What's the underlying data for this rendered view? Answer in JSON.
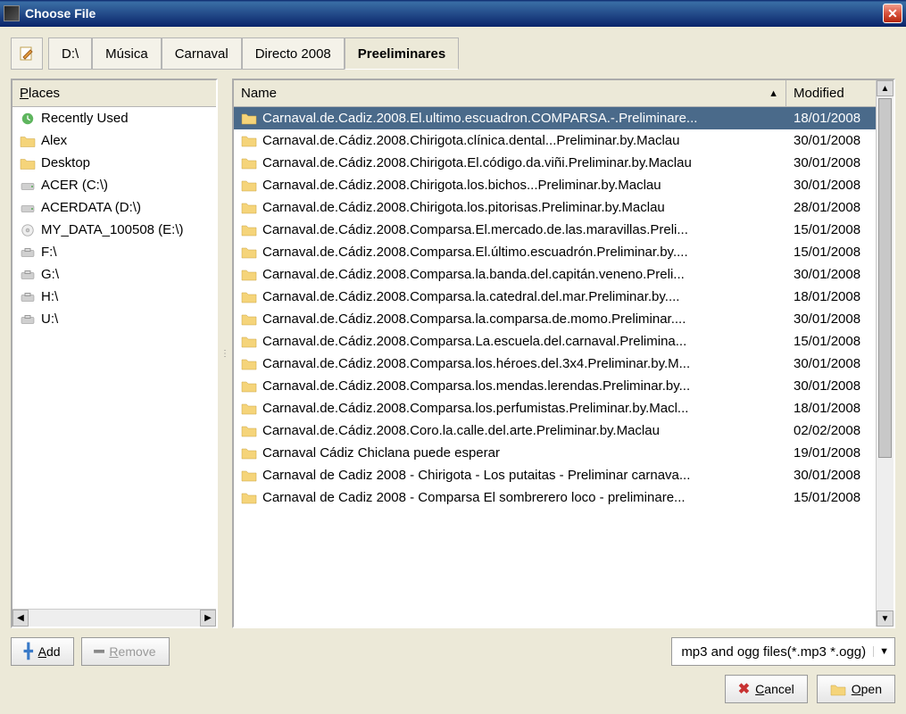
{
  "window": {
    "title": "Choose File"
  },
  "breadcrumb": [
    "D:\\",
    "Música",
    "Carnaval",
    "Directo 2008",
    "Preeliminares"
  ],
  "breadcrumb_active_index": 4,
  "places": {
    "header": "Places",
    "items": [
      {
        "label": "Recently Used",
        "icon": "recent"
      },
      {
        "label": "Alex",
        "icon": "folder"
      },
      {
        "label": "Desktop",
        "icon": "folder"
      },
      {
        "label": "ACER (C:\\)",
        "icon": "drive"
      },
      {
        "label": "ACERDATA (D:\\)",
        "icon": "drive"
      },
      {
        "label": "MY_DATA_100508 (E:\\)",
        "icon": "cd"
      },
      {
        "label": "F:\\",
        "icon": "removable"
      },
      {
        "label": "G:\\",
        "icon": "removable"
      },
      {
        "label": "H:\\",
        "icon": "removable"
      },
      {
        "label": "U:\\",
        "icon": "removable"
      }
    ]
  },
  "files": {
    "col_name": "Name",
    "col_modified": "Modified",
    "rows": [
      {
        "name": "Carnaval.de.Cadiz.2008.El.ultimo.escuadron.COMPARSA.-.Preliminare...",
        "modified": "18/01/2008",
        "selected": true
      },
      {
        "name": "Carnaval.de.Cádiz.2008.Chirigota.clínica.dental...Preliminar.by.Maclau",
        "modified": "30/01/2008"
      },
      {
        "name": "Carnaval.de.Cádiz.2008.Chirigota.El.código.da.viñi.Preliminar.by.Maclau",
        "modified": "30/01/2008"
      },
      {
        "name": "Carnaval.de.Cádiz.2008.Chirigota.los.bichos...Preliminar.by.Maclau",
        "modified": "30/01/2008"
      },
      {
        "name": "Carnaval.de.Cádiz.2008.Chirigota.los.pitorisas.Preliminar.by.Maclau",
        "modified": "28/01/2008"
      },
      {
        "name": "Carnaval.de.Cádiz.2008.Comparsa.El.mercado.de.las.maravillas.Preli...",
        "modified": "15/01/2008"
      },
      {
        "name": "Carnaval.de.Cádiz.2008.Comparsa.El.último.escuadrón.Preliminar.by....",
        "modified": "15/01/2008"
      },
      {
        "name": "Carnaval.de.Cádiz.2008.Comparsa.la.banda.del.capitán.veneno.Preli...",
        "modified": "30/01/2008"
      },
      {
        "name": "Carnaval.de.Cádiz.2008.Comparsa.la.catedral.del.mar.Preliminar.by....",
        "modified": "18/01/2008"
      },
      {
        "name": "Carnaval.de.Cádiz.2008.Comparsa.la.comparsa.de.momo.Preliminar....",
        "modified": "30/01/2008"
      },
      {
        "name": "Carnaval.de.Cádiz.2008.Comparsa.La.escuela.del.carnaval.Prelimina...",
        "modified": "15/01/2008"
      },
      {
        "name": "Carnaval.de.Cádiz.2008.Comparsa.los.héroes.del.3x4.Preliminar.by.M...",
        "modified": "30/01/2008"
      },
      {
        "name": "Carnaval.de.Cádiz.2008.Comparsa.los.mendas.lerendas.Preliminar.by...",
        "modified": "30/01/2008"
      },
      {
        "name": "Carnaval.de.Cádiz.2008.Comparsa.los.perfumistas.Preliminar.by.Macl...",
        "modified": "18/01/2008"
      },
      {
        "name": "Carnaval.de.Cádiz.2008.Coro.la.calle.del.arte.Preliminar.by.Maclau",
        "modified": "02/02/2008"
      },
      {
        "name": "Carnaval Cádiz Chiclana puede esperar",
        "modified": "19/01/2008"
      },
      {
        "name": "Carnaval de Cadiz 2008 - Chirigota - Los putaitas - Preliminar carnava...",
        "modified": "30/01/2008"
      },
      {
        "name": "Carnaval de Cadiz 2008 - Comparsa El sombrerero loco - preliminare...",
        "modified": "15/01/2008"
      }
    ]
  },
  "buttons": {
    "add": "Add",
    "remove": "Remove",
    "cancel": "Cancel",
    "open": "Open"
  },
  "filter": {
    "label": "mp3 and ogg files(*.mp3 *.ogg)"
  }
}
